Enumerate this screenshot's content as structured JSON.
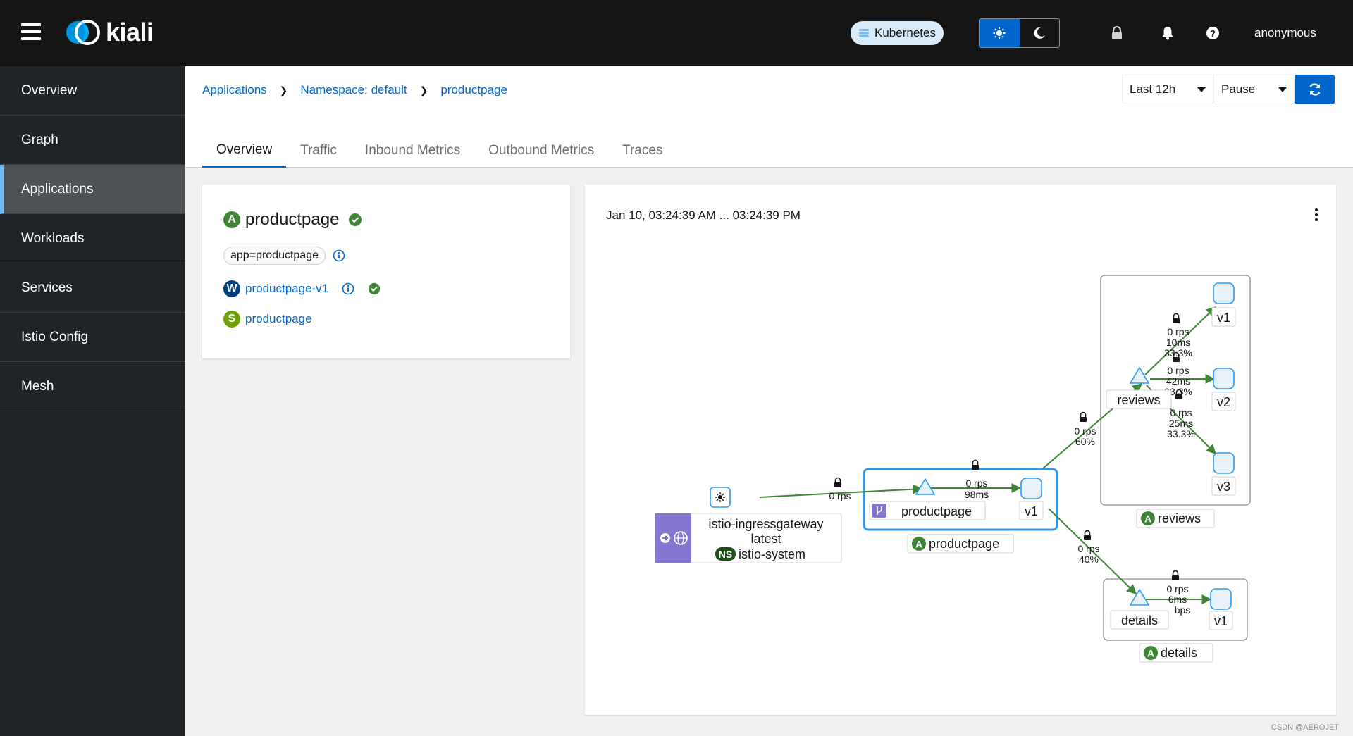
{
  "masthead": {
    "brand": "kiali",
    "cluster": "Kubernetes",
    "user": "anonymous",
    "colors": {
      "bg": "#151515",
      "accent": "#0066cc"
    }
  },
  "sidebar": {
    "items": [
      {
        "label": "Overview"
      },
      {
        "label": "Graph"
      },
      {
        "label": "Applications",
        "active": true
      },
      {
        "label": "Workloads"
      },
      {
        "label": "Services"
      },
      {
        "label": "Istio Config"
      },
      {
        "label": "Mesh"
      }
    ]
  },
  "breadcrumb": {
    "items": [
      "Applications",
      "Namespace: default",
      "productpage"
    ]
  },
  "time_controls": {
    "range": "Last 12h",
    "refresh": "Pause"
  },
  "tabs": [
    "Overview",
    "Traffic",
    "Inbound Metrics",
    "Outbound Metrics",
    "Traces"
  ],
  "app_card": {
    "badge": "A",
    "name": "productpage",
    "label": "app=productpage",
    "workload_badge": "W",
    "workload": "productpage-v1",
    "service_badge": "S",
    "service": "productpage"
  },
  "graph": {
    "time_range": "Jan 10, 03:24:39 AM ... 03:24:39 PM",
    "gateway": {
      "name": "istio-ingressgateway",
      "version": "latest",
      "ns_badge": "NS",
      "namespace": "istio-system"
    },
    "labels": {
      "productpage": "productpage",
      "v1": "v1",
      "v2": "v2",
      "v3": "v3",
      "reviews": "reviews",
      "details": "details",
      "app_badge": "A"
    },
    "edges": {
      "gw_pp": "0 rps",
      "pp_svc_rps": "0 rps",
      "pp_svc_ms": "98ms",
      "pp_reviews_rps": "0 rps",
      "pp_reviews_pct": "60%",
      "pp_details_rps": "0 rps",
      "pp_details_pct": "40%",
      "rv1_rps": "0 rps",
      "rv1_ms": "10ms",
      "rv1_pct": "33.3%",
      "rv2_rps": "0 rps",
      "rv2_ms": "42ms",
      "rv2_pct": "33.3%",
      "rv3_rps": "0 rps",
      "rv3_ms": "25ms",
      "rv3_pct": "33.3%",
      "det_rps": "0 rps",
      "det_ms": "6ms",
      "det_bps": "bps"
    }
  },
  "watermark": "CSDN @AEROJET"
}
